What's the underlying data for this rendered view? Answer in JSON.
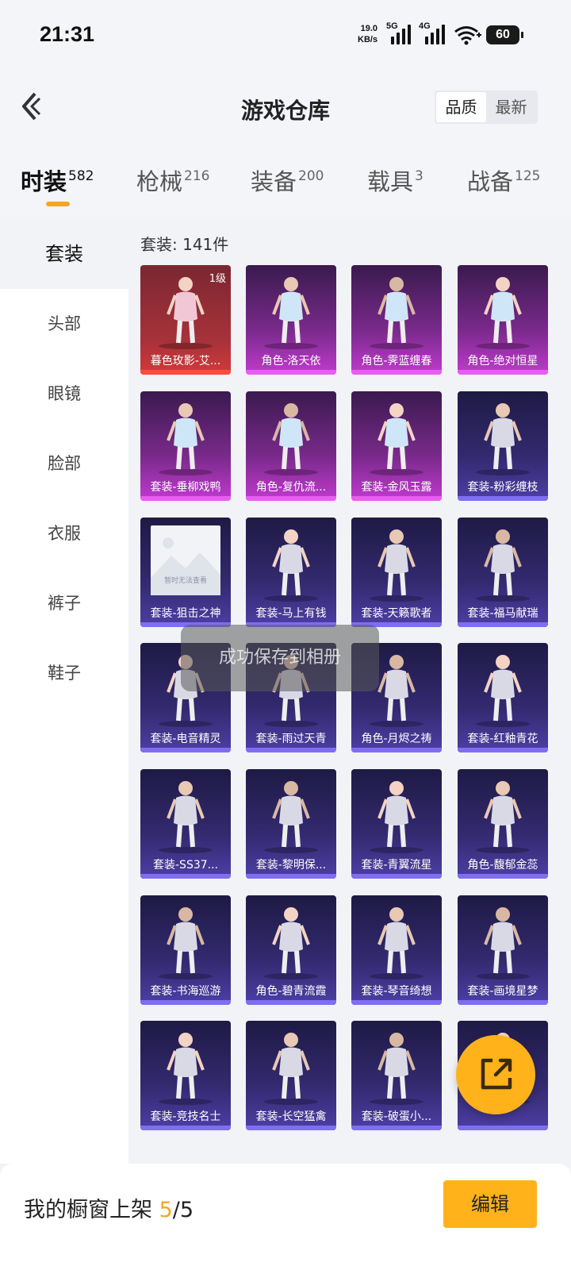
{
  "status_bar": {
    "time": "21:31",
    "net_speed_value": "19.0",
    "net_speed_unit": "KB/s",
    "network_1": "5G",
    "network_2": "4G",
    "battery": "60"
  },
  "header": {
    "title": "游戏仓库",
    "sort_options": [
      "品质",
      "最新"
    ],
    "sort_active": "品质"
  },
  "category_tabs": [
    {
      "label": "时装",
      "count": "582",
      "active": true
    },
    {
      "label": "枪械",
      "count": "216"
    },
    {
      "label": "装备",
      "count": "200"
    },
    {
      "label": "载具",
      "count": "3"
    },
    {
      "label": "战备",
      "count": "125"
    }
  ],
  "sidebar": {
    "items": [
      "套装",
      "头部",
      "眼镜",
      "脸部",
      "衣服",
      "裤子",
      "鞋子"
    ],
    "active": "套装"
  },
  "content": {
    "count_label": "套装: 141件",
    "items": [
      {
        "name": "暮色玫影-艾...",
        "quality": "red",
        "level": "1级"
      },
      {
        "name": "角色-洛天依",
        "quality": "pink"
      },
      {
        "name": "角色-霁蓝缠春",
        "quality": "pink"
      },
      {
        "name": "角色-绝对恒星",
        "quality": "pink"
      },
      {
        "name": "套装-垂柳戏鸭",
        "quality": "pink"
      },
      {
        "name": "角色-复仇流...",
        "quality": "pink"
      },
      {
        "name": "套装-金风玉露",
        "quality": "pink"
      },
      {
        "name": "套装-粉彩缠枝",
        "quality": "purple"
      },
      {
        "name": "套装-狙击之神",
        "quality": "purple",
        "placeholder_text": "暂时无法查看"
      },
      {
        "name": "套装-马上有钱",
        "quality": "purple"
      },
      {
        "name": "套装-天籁歌者",
        "quality": "purple"
      },
      {
        "name": "套装-福马献瑞",
        "quality": "purple"
      },
      {
        "name": "套装-电音精灵",
        "quality": "purple"
      },
      {
        "name": "套装-雨过天青",
        "quality": "purple"
      },
      {
        "name": "角色-月烬之祷",
        "quality": "purple"
      },
      {
        "name": "套装-红釉青花",
        "quality": "purple"
      },
      {
        "name": "套装-SS37...",
        "quality": "purple"
      },
      {
        "name": "套装-黎明保...",
        "quality": "purple"
      },
      {
        "name": "套装-青翼流星",
        "quality": "purple"
      },
      {
        "name": "角色-馥郁金蕊",
        "quality": "purple"
      },
      {
        "name": "套装-书海巡游",
        "quality": "purple"
      },
      {
        "name": "角色-碧青流霞",
        "quality": "purple"
      },
      {
        "name": "套装-琴音绮想",
        "quality": "purple"
      },
      {
        "name": "套装-画境星梦",
        "quality": "purple"
      },
      {
        "name": "套装-竞技名士",
        "quality": "purple"
      },
      {
        "name": "套装-长空猛禽",
        "quality": "purple"
      },
      {
        "name": "套装-破蛋小...",
        "quality": "purple"
      },
      {
        "name": "",
        "quality": "purple"
      }
    ]
  },
  "toast": "成功保存到相册",
  "bottom_bar": {
    "showcase_label": "我的橱窗上架",
    "showcase_current": "5",
    "showcase_sep": "/",
    "showcase_total": "5",
    "edit_label": "编辑"
  },
  "colors": {
    "accent": "#ffb21a",
    "quality_red": "#ff4a3d",
    "quality_pink": "#e65ef0",
    "quality_purple": "#7e6ef0"
  }
}
